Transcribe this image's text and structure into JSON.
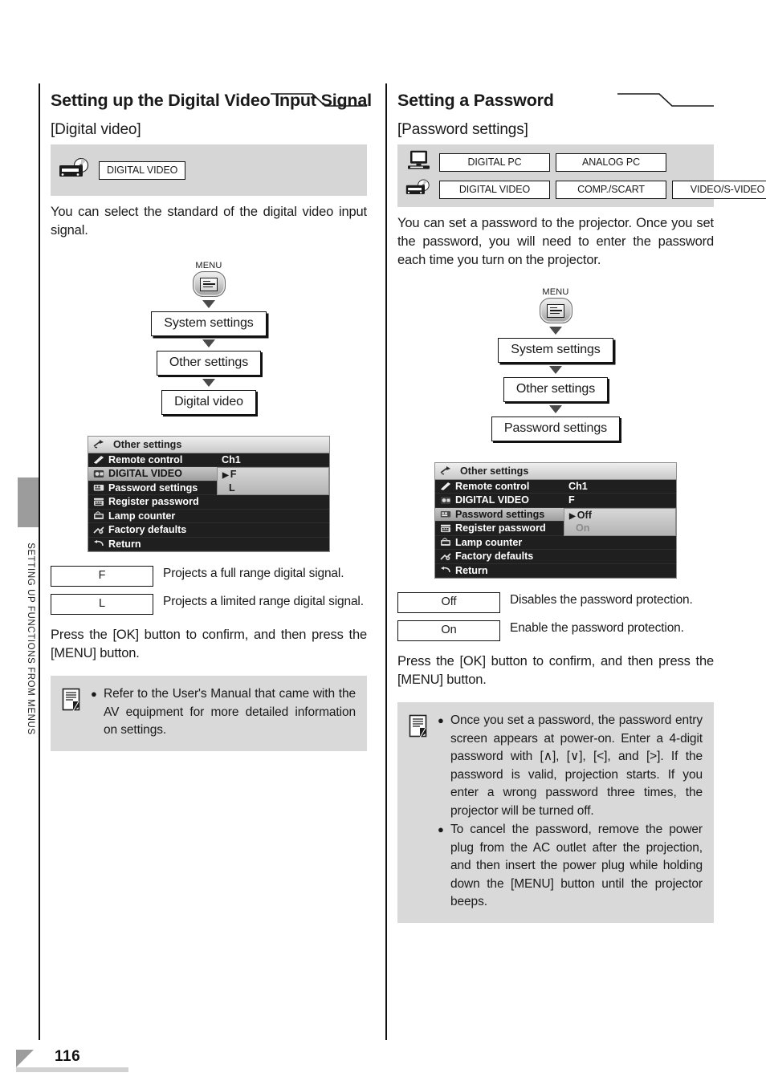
{
  "sidebar": {
    "running_head": "SETTING UP FUNCTIONS FROM MENUS",
    "page_number": "116"
  },
  "left_column": {
    "title": "Setting up the Digital Video Input Signal",
    "subtitle": "[Digital video]",
    "signal_rows": [
      {
        "icon": "av-player-icon",
        "tags": [
          "DIGITAL VIDEO"
        ]
      }
    ],
    "intro": "You can select the standard of the digital video input signal.",
    "flow": {
      "menu_caption": "MENU",
      "menu_icon": "menu-button-icon",
      "steps": [
        "System settings",
        "Other settings",
        "Digital video"
      ]
    },
    "osd": {
      "title": "Other settings",
      "title_icon": "other-settings-icon",
      "rows": [
        {
          "icon": "remote-control-icon",
          "label": "Remote control",
          "value": "Ch1",
          "selected": false
        },
        {
          "icon": "digital-video-icon",
          "label": "DIGITAL VIDEO",
          "value": "",
          "selected": true
        },
        {
          "icon": "password-settings-icon",
          "label": "Password settings",
          "value": "",
          "selected": false
        },
        {
          "icon": "register-password-icon",
          "label": "Register password",
          "value": "",
          "selected": false
        },
        {
          "icon": "lamp-counter-icon",
          "label": "Lamp counter",
          "value": "",
          "selected": false
        },
        {
          "icon": "factory-defaults-icon",
          "label": "Factory defaults",
          "value": "",
          "selected": false
        },
        {
          "icon": "return-icon",
          "label": "Return",
          "value": "",
          "selected": false
        }
      ],
      "popup": {
        "options": [
          {
            "label": "F",
            "marked": true,
            "dim": false
          },
          {
            "label": "L",
            "marked": false,
            "dim": false
          }
        ]
      }
    },
    "options": [
      {
        "key": "F",
        "desc": "Projects a full range digital signal."
      },
      {
        "key": "L",
        "desc": "Projects a limited range digital signal."
      }
    ],
    "press_note": "Press the [OK] button to confirm, and then press the [MENU] button.",
    "note": {
      "icon": "note-memo-icon",
      "items": [
        "Refer to the User's Manual that came with the AV equipment for more detailed information on settings."
      ]
    }
  },
  "right_column": {
    "title": "Setting a Password",
    "subtitle": "[Password settings]",
    "signal_rows": [
      {
        "icon": "computer-monitor-icon",
        "tags": [
          "DIGITAL PC",
          "ANALOG PC"
        ]
      },
      {
        "icon": "av-player-icon",
        "tags": [
          "DIGITAL VIDEO",
          "COMP./SCART",
          "VIDEO/S-VIDEO"
        ]
      }
    ],
    "intro": "You can set a password to the projector. Once you set the password, you will need to enter the password each time you turn on the projector.",
    "flow": {
      "menu_caption": "MENU",
      "menu_icon": "menu-button-icon",
      "steps": [
        "System settings",
        "Other settings",
        "Password settings"
      ]
    },
    "osd": {
      "title": "Other settings",
      "title_icon": "other-settings-icon",
      "rows": [
        {
          "icon": "remote-control-icon",
          "label": "Remote control",
          "value": "Ch1",
          "selected": false
        },
        {
          "icon": "digital-video-icon",
          "label": "DIGITAL VIDEO",
          "value": "F",
          "selected": false
        },
        {
          "icon": "password-settings-icon",
          "label": "Password settings",
          "value": "",
          "selected": true
        },
        {
          "icon": "register-password-icon",
          "label": "Register password",
          "value": "",
          "selected": false
        },
        {
          "icon": "lamp-counter-icon",
          "label": "Lamp counter",
          "value": "",
          "selected": false
        },
        {
          "icon": "factory-defaults-icon",
          "label": "Factory defaults",
          "value": "",
          "selected": false
        },
        {
          "icon": "return-icon",
          "label": "Return",
          "value": "",
          "selected": false
        }
      ],
      "popup": {
        "options": [
          {
            "label": "Off",
            "marked": true,
            "dim": false
          },
          {
            "label": "On",
            "marked": false,
            "dim": true
          }
        ]
      }
    },
    "options": [
      {
        "key": "Off",
        "desc": "Disables the password protection."
      },
      {
        "key": "On",
        "desc": "Enable the password protection."
      }
    ],
    "press_note": "Press the [OK] button to confirm, and then press the [MENU] button.",
    "note": {
      "icon": "note-memo-icon",
      "items": [
        "Once you set a password, the password entry screen appears at power-on. Enter a 4-digit password with [∧], [∨], [<], and [>]. If the password is valid, projection starts. If you enter a wrong password three times, the projector will be turned off.",
        "To cancel the password, remove the power plug from the AC outlet after the projection, and then insert the power plug while holding down the [MENU] button until the projector beeps."
      ]
    }
  },
  "colors": {
    "banner_gray": "#d6d6d6",
    "note_gray": "#d9d9d9",
    "tab_gray": "#9c9c9c",
    "osd_dark": "#1f1f1f",
    "osd_highlight": "#c7c7c7"
  }
}
